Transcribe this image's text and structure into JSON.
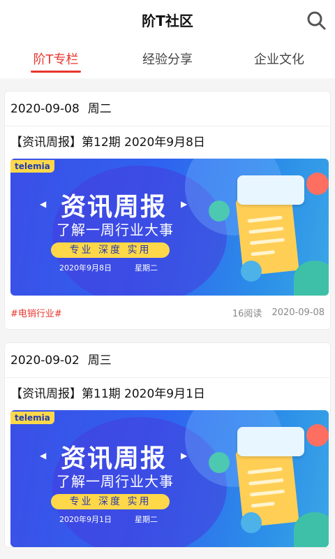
{
  "header": {
    "title": "阶T社区",
    "search_icon": "search-icon"
  },
  "tabs": [
    {
      "label": "阶T专栏",
      "active": true
    },
    {
      "label": "经验分享",
      "active": false
    },
    {
      "label": "企业文化",
      "active": false
    }
  ],
  "colors": {
    "accent": "#e8352e",
    "banner_yellow": "#ffd84a"
  },
  "cards": [
    {
      "date": "2020-09-08",
      "weekday": "周二",
      "title": "【资讯周报】第12期 2020年9月8日",
      "banner": {
        "brand": "telemia",
        "headline": "资讯周报",
        "subline": "了解一周行业大事",
        "pill": "专业 深度 实用",
        "date": "2020年9月8日",
        "weekday": "星期二"
      },
      "tag": "#电销行业#",
      "reads": "16阅读",
      "meta_date": "2020-09-08"
    },
    {
      "date": "2020-09-02",
      "weekday": "周三",
      "title": "【资讯周报】第11期 2020年9月1日",
      "banner": {
        "brand": "telemia",
        "headline": "资讯周报",
        "subline": "了解一周行业大事",
        "pill": "专业 深度 实用",
        "date": "2020年9月1日",
        "weekday": "星期二"
      },
      "tag": "",
      "reads": "",
      "meta_date": ""
    }
  ]
}
